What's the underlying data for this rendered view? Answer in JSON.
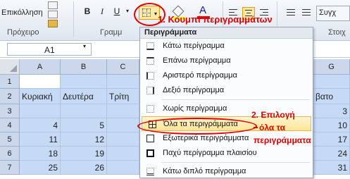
{
  "ribbon": {
    "paste_label": "Επικόλληση",
    "clipboard_group": "Πρόχειρο",
    "font_group": "Γραμμ",
    "align_group": "Στοιχ",
    "bold": "B",
    "italic": "I",
    "underline": "U",
    "font_color_glyph": "A",
    "wrap_label": "Συγχ"
  },
  "formula_bar": {
    "name_box": "A1"
  },
  "grid": {
    "columns": [
      "A",
      "B",
      "C",
      "G"
    ],
    "rows": [
      "1",
      "2",
      "3",
      "4",
      "5",
      "6",
      "7"
    ],
    "row2": [
      "Κυριακή",
      "Δευτέρα",
      "Τρίτη",
      "βατο"
    ],
    "row3": [
      "",
      "",
      "",
      "3"
    ],
    "row4": [
      "4",
      "5",
      "",
      "10"
    ],
    "row5": [
      "11",
      "12",
      "",
      "17"
    ],
    "row6": [
      "18",
      "19",
      "",
      "24"
    ],
    "row7": [
      "25",
      "26",
      "",
      "31"
    ]
  },
  "borders_menu": {
    "header": "Περιγράμματα",
    "items": [
      {
        "label": "Κάτω περίγραμμα",
        "icon": "bottom-border-icon"
      },
      {
        "label": "Επάνω περίγραμμα",
        "icon": "top-border-icon"
      },
      {
        "label": "Αριστερό περίγραμμα",
        "icon": "left-border-icon"
      },
      {
        "label": "Δεξιό περίγραμμα",
        "icon": "right-border-icon"
      },
      {
        "label": "Χωρίς περίγραμμα",
        "icon": "no-border-icon"
      },
      {
        "label": "Όλα τα περιγράμματα",
        "icon": "all-borders-icon"
      },
      {
        "label": "Εξωτερικά περιγράμματα",
        "icon": "outside-borders-icon"
      },
      {
        "label": "Παχύ περίγραμμα πλαισίου",
        "icon": "thick-box-border-icon"
      },
      {
        "label": "Κάτω διπλό περίγραμμα",
        "icon": "bottom-double-border-icon"
      }
    ]
  },
  "annotations": {
    "step1": "1. Κουμπί περιγραμμάτων",
    "step2_line1": "2. Επιλογή",
    "step2_line2": "όλα τα",
    "step2_line3": "περιγράμματα"
  },
  "colors": {
    "annotation_red": "#e00000",
    "selection_blue": "#c6daf5",
    "highlight_yellow": "#ffe59a"
  }
}
